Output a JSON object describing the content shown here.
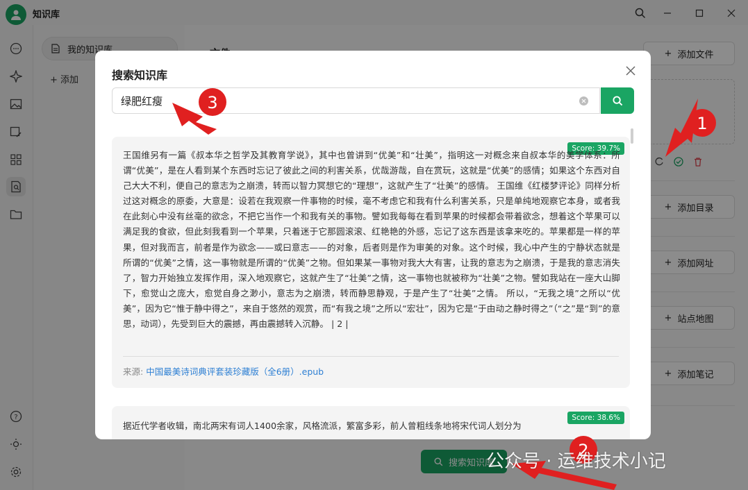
{
  "app": {
    "title": "知识库",
    "kb_item": "我的知识库",
    "add_label": "添加",
    "main_title": "文件",
    "buttons": {
      "add_file": "添加文件",
      "add_dir": "添加目录",
      "add_url": "添加网址",
      "sitemap": "站点地图",
      "add_note": "添加笔记",
      "search_kb": "搜索知识库"
    }
  },
  "modal": {
    "title": "搜索知识库",
    "query": "绿肥红瘦",
    "results": [
      {
        "score": "Score: 39.7%",
        "text": "王国维另有一篇《叔本华之哲学及其教育学说》，其中也曾讲到“优美”和“壮美”，指明这一对概念来自叔本华的美学体系：所谓“优美”，是在人看到某个东西时忘记了彼此之间的利害关系，优哉游哉，自在赏玩，这就是“优美”的感情；如果这个东西对自己大大不利，便自己的意志为之崩溃，转而以智力冥想它的“理想”，这就产生了“壮美”的感情。 王国维《红楼梦评论》同样分析过这对概念的原委，大意是：设若在我观察一件事物的时候，毫不考虑它和我有什么利害关系，只是单纯地观察它本身，或者我在此刻心中没有丝毫的欲念，不把它当作一个和我有关的事物。譬如我每每在看到苹果的时候都会带着欲念，想着这个苹果可以满足我的食欲，但此刻我看到一个苹果，只着迷于它那圆滚滚、红艳艳的外感，忘记了这东西是该拿来吃的。苹果都是一样的苹果，但对我而言，前者是作为欲念——或曰意志——的对象，后者则是作为审美的对象。这个时候，我心中产生的宁静状态就是所谓的“优美”之情，这一事物就是所谓的“优美”之物。但如果某一事物对我大大有害，让我的意志为之崩溃，于是我的意志消失了，智力开始独立发挥作用，深入地观察它，这就产生了“壮美”之情，这一事物也就被称为“壮美”之物。譬如我站在一座大山脚下，愈觉山之庞大，愈觉自身之渺小，意志为之崩溃，转而静思静观，于是产生了“壮美”之情。 所以，“无我之境”之所以“优美”，因为它“惟于静中得之”，来自于悠然的观赏，而“有我之境”之所以“宏壮”，因为它是“于由动之静时得之”（“之”是“到”的意思，动词），先受到巨大的震撼，再由震撼转入沉静。 | 2 |",
        "source_label": "来源:",
        "source": "中国最美诗词典评套装珍藏版（全6册）.epub"
      },
      {
        "score": "Score: 38.6%",
        "text": "据近代学者收辑，南北两宋有词人1400余家，风格流派，繁富多彩，前人曾粗线条地将宋代词人划分为"
      }
    ]
  },
  "annotations": {
    "marker_1": "1",
    "marker_2": "2",
    "marker_3": "3",
    "watermark": "公众号 · 运维技术小记"
  }
}
